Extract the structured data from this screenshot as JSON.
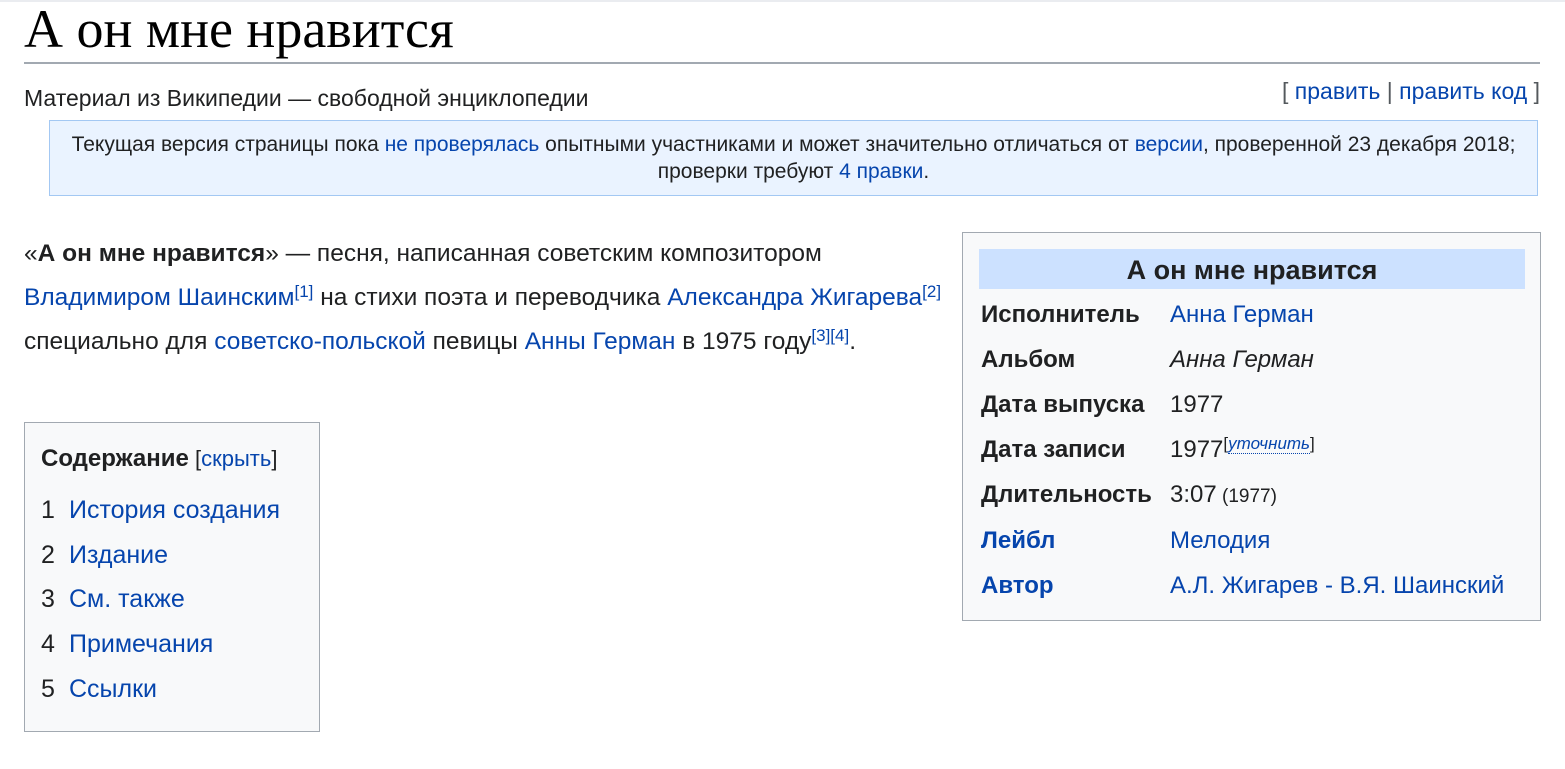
{
  "page": {
    "title": "А он мне нравится",
    "tagline": "Материал из Википедии — свободной энциклопедии",
    "edit_links": {
      "open": "[",
      "edit": "править",
      "sep": "|",
      "edit_code": "править код",
      "close": "]"
    }
  },
  "notice": {
    "t1": "Текущая версия страницы пока ",
    "l1": "не проверялась",
    "t2": " опытными участниками и может значительно отличаться от ",
    "l2": "версии",
    "t3": ", проверенной 23 декабря 2018; проверки требуют ",
    "l3": "4 правки",
    "t4": "."
  },
  "lead": {
    "q_open": "«",
    "bold": "А он мне нравится",
    "t1": "» — песня, написанная советским композитором ",
    "l_composer": "Владимиром Шаинским",
    "ref1": "[1]",
    "t2": " на стихи поэта и переводчика ",
    "l_poet": "Александра Жигарева",
    "ref2": "[2]",
    "t3": " специально для ",
    "l_country": "советско-польской",
    "t4": " певицы ",
    "l_singer": "Анны Герман",
    "t5": " в 1975 году",
    "ref3": "[3]",
    "ref4": "[4]",
    "t6": "."
  },
  "toc": {
    "title": "Содержание",
    "hide_open": " [",
    "hide": "скрыть",
    "hide_close": "]",
    "items": [
      {
        "num": "1",
        "label": "История создания"
      },
      {
        "num": "2",
        "label": "Издание"
      },
      {
        "num": "3",
        "label": "См. также"
      },
      {
        "num": "4",
        "label": "Примечания"
      },
      {
        "num": "5",
        "label": "Ссылки"
      }
    ]
  },
  "infobox": {
    "header": "А он мне нравится",
    "performer_label": "Исполнитель",
    "performer_value": "Анна Герман",
    "album_label": "Альбом",
    "album_value": "Анна Герман",
    "release_label": "Дата выпуска",
    "release_value": "1977",
    "recorded_label": "Дата записи",
    "recorded_value": "1977",
    "recorded_note_open": "[",
    "recorded_note": "уточнить",
    "recorded_note_close": "]",
    "length_label": "Длительность",
    "length_value": "3:07",
    "length_note": " (1977)",
    "label_label": "Лейбл",
    "label_value": "Мелодия",
    "author_label": "Автор",
    "author_value": "А.Л. Жигарев - В.Я. Шаинский"
  }
}
